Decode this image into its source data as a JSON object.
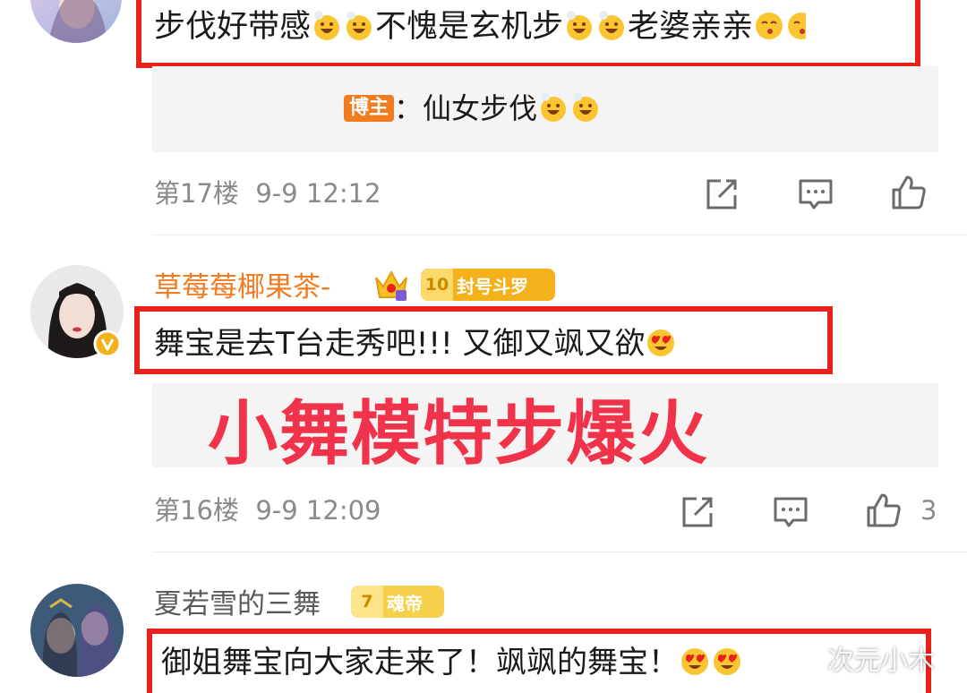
{
  "comments": [
    {
      "text_parts": [
        "步伐好带感",
        "不愧是玄机步",
        "老婆亲亲"
      ],
      "reply": {
        "author_tag": "博主",
        "separator": "：",
        "text": "仙女步伐"
      },
      "floor": "第17楼",
      "time": "9-9 12:12"
    },
    {
      "username": "草莓莓椰果茶-",
      "fan_badge": {
        "level": "10",
        "title": "封号斗罗"
      },
      "text": "舞宝是去T台走秀吧!!! 又御又飒又欲",
      "floor": "第16楼",
      "time": "9-9 12:09",
      "like_count": "3"
    },
    {
      "username": "夏若雪的三舞",
      "fan_badge": {
        "level": "7",
        "title": "魂帝"
      },
      "text": "御姐舞宝向大家走来了！飒飒的舞宝！"
    }
  ],
  "overlay_title": "小舞模特步爆火",
  "watermark": "次元小木",
  "icons": [
    "share-icon",
    "comment-icon",
    "like-icon",
    "verified-icon",
    "crown-icon"
  ],
  "colors": {
    "highlight_red": "#e8221b",
    "overlay_text": "#f0334a",
    "username_orange": "#f27a1f",
    "badge_gold": "#f3b21b",
    "meta_gray": "#8a8a8a"
  }
}
